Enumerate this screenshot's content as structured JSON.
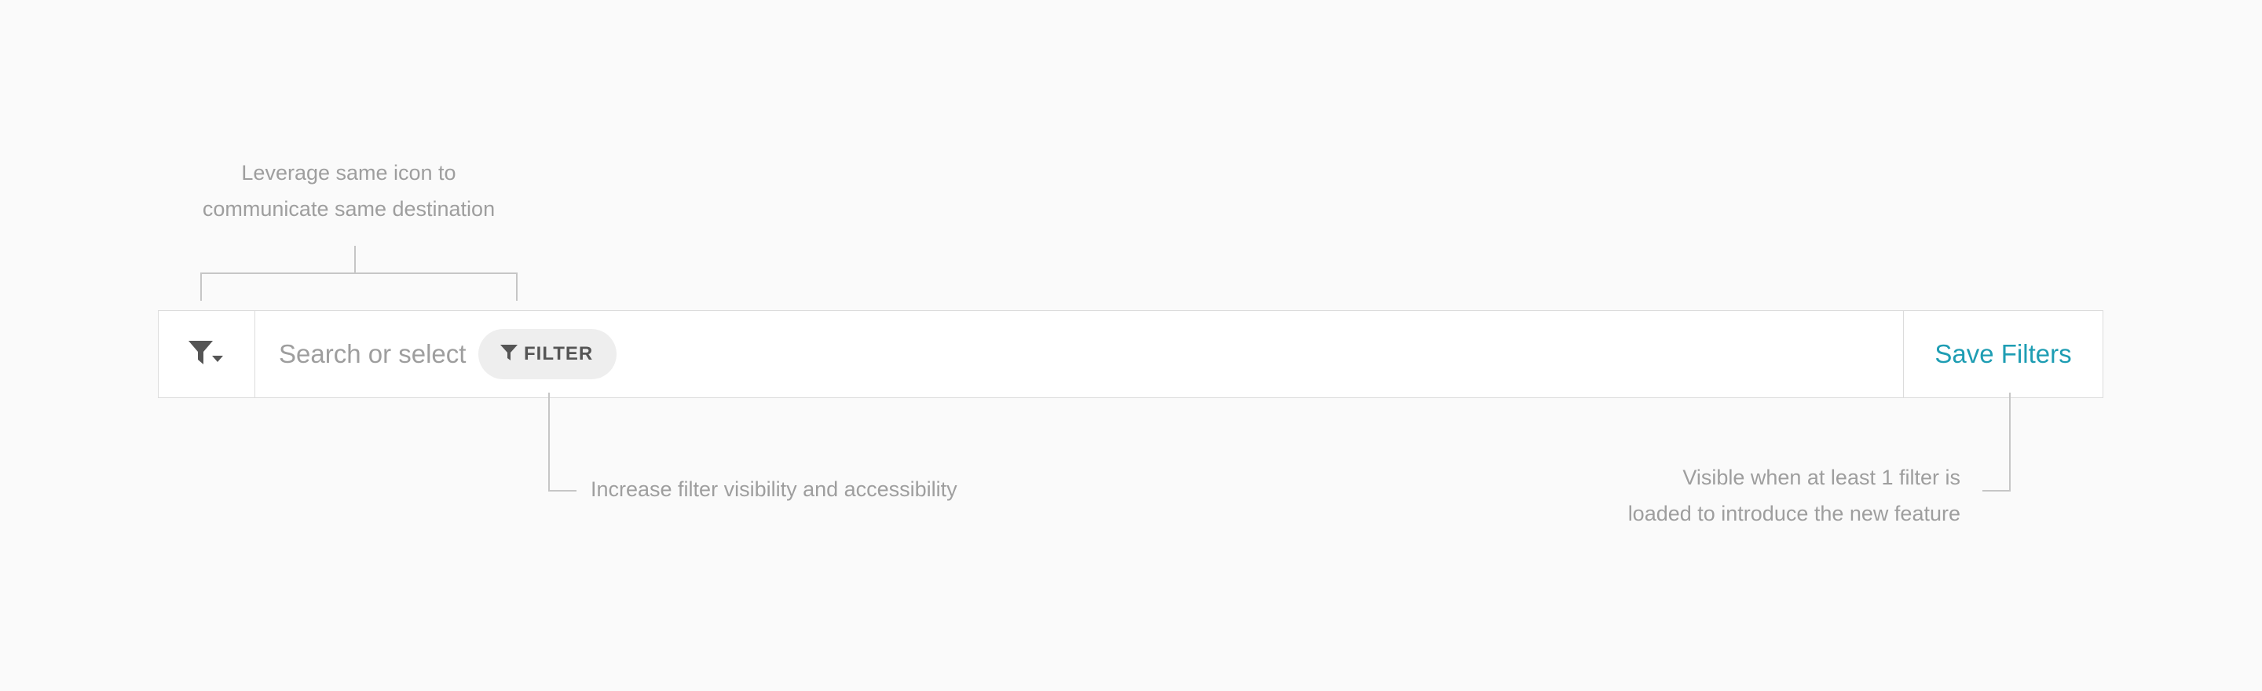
{
  "annotations": {
    "icon_note": {
      "line1": "Leverage same icon to",
      "line2": "communicate same destination"
    },
    "filter_note": "Increase filter visibility and accessibility",
    "save_note": {
      "line1": "Visible when at least 1 filter is",
      "line2": "loaded to introduce the new feature"
    }
  },
  "search_bar": {
    "filter_menu_icon": "filter-dropdown-icon",
    "placeholder": "Search or select",
    "chip": {
      "icon": "filter-icon",
      "label": "FILTER"
    },
    "save_label": "Save Filters"
  },
  "colors": {
    "background": "#fafafa",
    "accent": "#1e9db3",
    "annotation_text": "#9e9e9e",
    "chip_bg": "#eeeeee"
  }
}
